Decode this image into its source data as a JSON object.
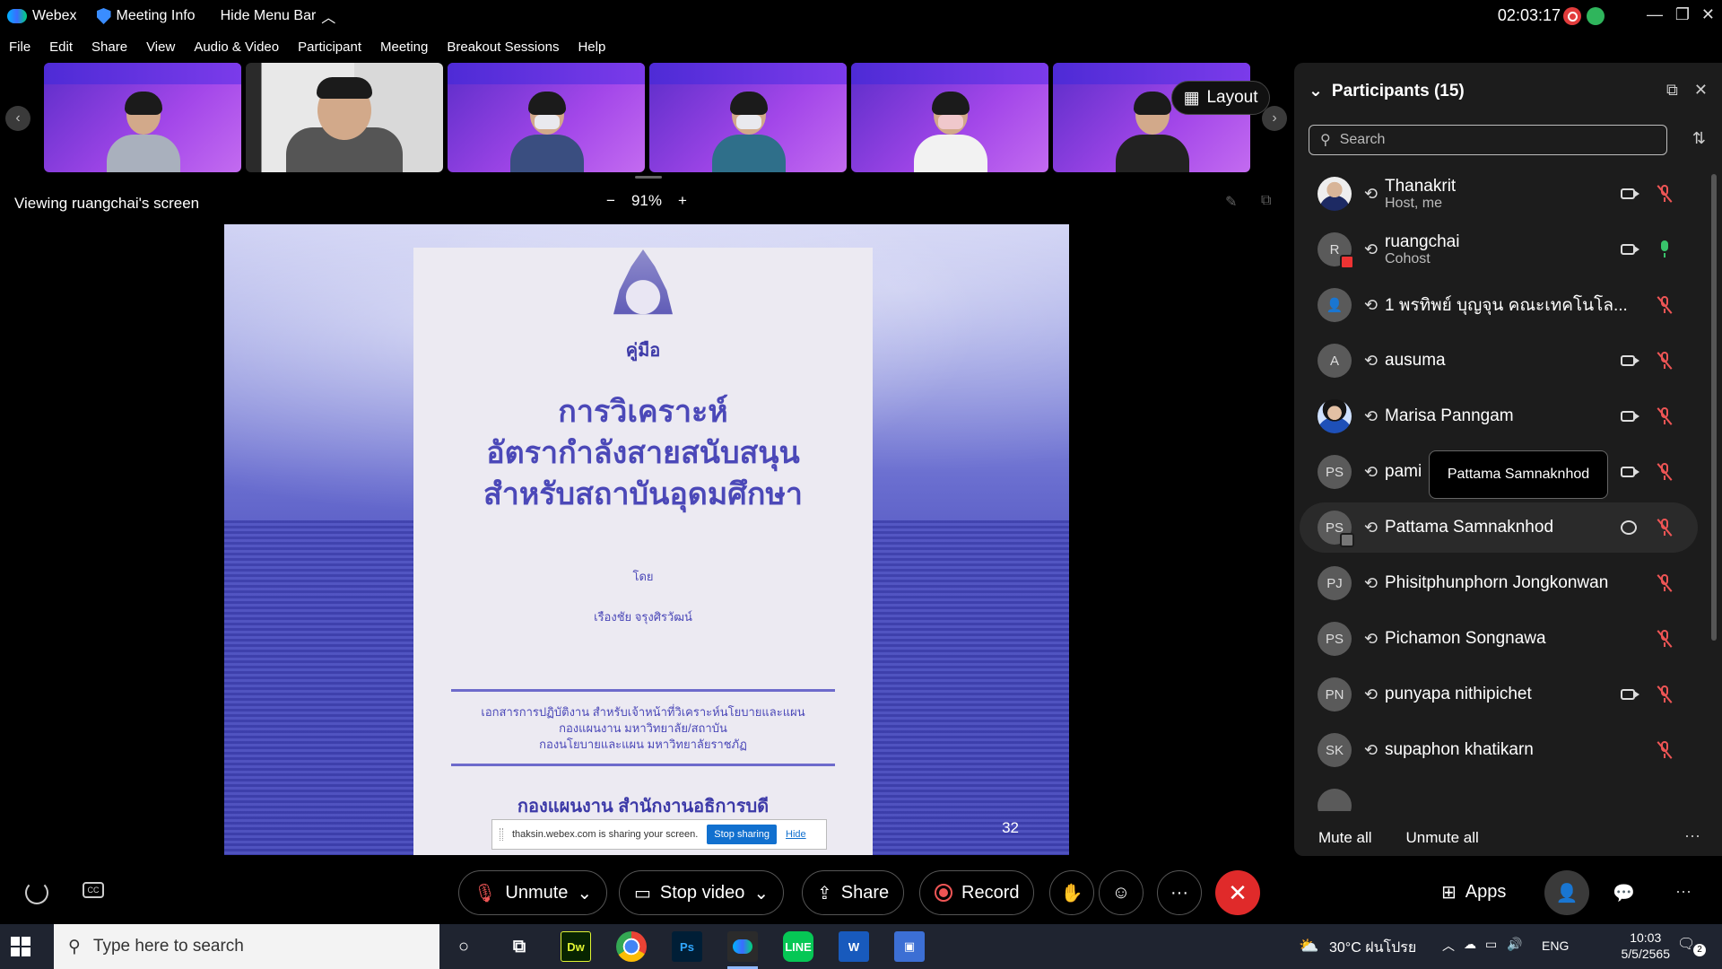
{
  "app": {
    "name": "Webex",
    "meeting_info": "Meeting Info",
    "hide_menu_bar": "Hide Menu Bar",
    "timer": "02:03:17"
  },
  "menu": [
    "File",
    "Edit",
    "Share",
    "View",
    "Audio & Video",
    "Participant",
    "Meeting",
    "Breakout Sessions",
    "Help"
  ],
  "thumbnails": {
    "layout_label": "Layout"
  },
  "viewing": {
    "label": "Viewing ruangchai's screen",
    "zoom": "91%",
    "zoom_minus": "−",
    "zoom_plus": "+"
  },
  "shared_doc": {
    "subtitle": "คู่มือ",
    "title_line1": "การวิเคราะห์",
    "title_line2": "อัตรากำลังสายสนับสนุน",
    "title_line3": "สำหรับสถาบันอุดมศึกษา",
    "by": "โดย",
    "author": "เรืองชัย  จรุงศิรวัฒน์",
    "desc_line1": "เอกสารการปฏิบัติงาน สำหรับเจ้าหน้าที่วิเคราะห์นโยบายและแผน",
    "desc_line2": "กองแผนงาน  มหาวิทยาลัย/สถาบัน",
    "desc_line3": "กองนโยบายและแผน  มหาวิทยาลัยราชภัฏ",
    "footer": "กองแผนงาน   สำนักงานอธิการบดี",
    "page_number": "32",
    "share_notice": "thaksin.webex.com is sharing your screen.",
    "stop_sharing": "Stop sharing",
    "hide": "Hide"
  },
  "participants_panel": {
    "title": "Participants (15)",
    "search_placeholder": "Search",
    "tooltip": "Pattama Samnaknhod",
    "mute_all": "Mute all",
    "unmute_all": "Unmute all",
    "participants": [
      {
        "name": "Thanakrit",
        "role": "Host, me",
        "avatar": "photo",
        "video": true,
        "mic": "muted"
      },
      {
        "name": "ruangchai",
        "role": "Cohost",
        "initials": "R",
        "video": true,
        "mic": "on"
      },
      {
        "name": "1 พรทิพย์ บุญจุน คณะเทคโนโล...",
        "role": "",
        "initials": "",
        "video": false,
        "mic": "muted"
      },
      {
        "name": "ausuma",
        "role": "",
        "initials": "A",
        "video": true,
        "mic": "muted"
      },
      {
        "name": "Marisa Panngam",
        "role": "",
        "avatar": "photo2",
        "video": true,
        "mic": "muted"
      },
      {
        "name": "pami",
        "role": "",
        "initials": "PS",
        "video": true,
        "mic": "muted"
      },
      {
        "name": "Pattama Samnaknhod",
        "role": "",
        "initials": "PS",
        "chat": true,
        "mic": "muted"
      },
      {
        "name": "Phisitphunphorn Jongkonwan",
        "role": "",
        "initials": "PJ",
        "video": false,
        "mic": "muted"
      },
      {
        "name": "Pichamon Songnawa",
        "role": "",
        "initials": "PS",
        "video": false,
        "mic": "muted"
      },
      {
        "name": "punyapa nithipichet",
        "role": "",
        "initials": "PN",
        "video": true,
        "mic": "muted"
      },
      {
        "name": "supaphon khatikarn",
        "role": "",
        "initials": "SK",
        "video": false,
        "mic": "muted"
      }
    ]
  },
  "controls": {
    "unmute": "Unmute",
    "stop_video": "Stop video",
    "share": "Share",
    "record": "Record",
    "apps": "Apps"
  },
  "taskbar": {
    "search_placeholder": "Type here to search",
    "weather": "30°C  ฝนโปรย",
    "lang": "ENG",
    "time": "10:03",
    "date": "5/5/2565",
    "notifications": "2",
    "apps": [
      "Dw",
      "Ps",
      "W"
    ]
  },
  "colors": {
    "end_call": "#e02a2a",
    "mic_muted": "#e55555",
    "mic_on": "#39c36b",
    "accent": "#1170cf"
  }
}
